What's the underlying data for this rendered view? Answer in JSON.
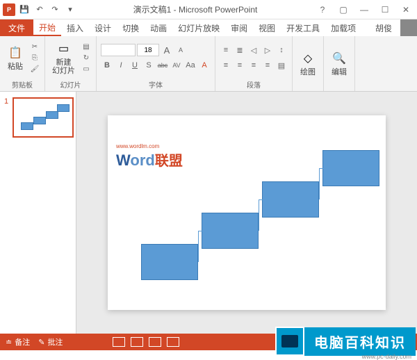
{
  "title": "演示文稿1 - Microsoft PowerPoint",
  "app_icon_text": "P",
  "tabs": {
    "file": "文件",
    "home": "开始",
    "insert": "插入",
    "design": "设计",
    "transitions": "切换",
    "animations": "动画",
    "slideshow": "幻灯片放映",
    "review": "审阅",
    "view": "视图",
    "developer": "开发工具",
    "addins": "加载项",
    "account": "胡俊"
  },
  "ribbon": {
    "paste": "粘贴",
    "clipboard": "剪贴板",
    "new_slide": "新建\n幻灯片",
    "slides": "幻灯片",
    "font_size": "18",
    "font_group": "字体",
    "para_group": "段落",
    "drawing": "绘图",
    "editing": "编辑",
    "bold": "B",
    "italic": "I",
    "underline": "U",
    "strike": "S",
    "abc": "abc",
    "av": "AV",
    "aa_big": "A",
    "aa_small": "A",
    "aa_case": "Aa"
  },
  "thumb_number": "1",
  "watermark": {
    "url": "www.wordlm.com",
    "w": "W",
    "ord": "ord",
    "lm": "联盟"
  },
  "status": {
    "notes": "备注",
    "comments": "批注"
  },
  "banner": {
    "text": "电脑百科知识",
    "url": "www.pc-daily.com"
  }
}
